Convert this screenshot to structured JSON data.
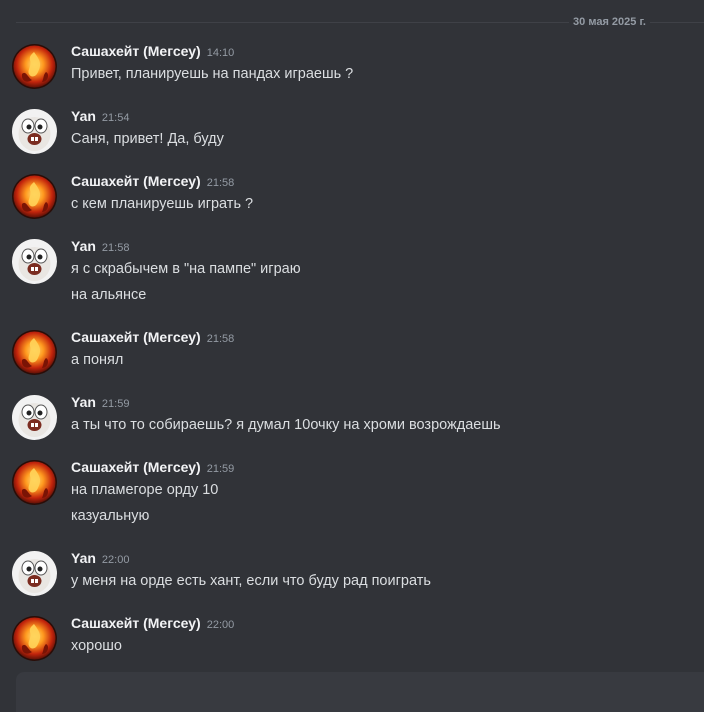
{
  "date_divider": "30 мая 2025 г.",
  "messages": [
    {
      "author": "Сашахейт (Мегсеу)",
      "time": "14:10",
      "avatar_icon": "fire-avatar-icon",
      "lines": [
        "Привет, планируешь на пандах играешь ?"
      ]
    },
    {
      "author": "Yan",
      "time": "21:54",
      "avatar_icon": "cartoon-face-avatar-icon",
      "lines": [
        "Саня, привет! Да, буду"
      ]
    },
    {
      "author": "Сашахейт (Мегсеу)",
      "time": "21:58",
      "avatar_icon": "fire-avatar-icon",
      "lines": [
        "с кем планируешь играть ?"
      ]
    },
    {
      "author": "Yan",
      "time": "21:58",
      "avatar_icon": "cartoon-face-avatar-icon",
      "lines": [
        "я с скрабычем в \"на пампе\" играю",
        "на альянсе"
      ]
    },
    {
      "author": "Сашахейт (Мегсеу)",
      "time": "21:58",
      "avatar_icon": "fire-avatar-icon",
      "lines": [
        "а понял"
      ]
    },
    {
      "author": "Yan",
      "time": "21:59",
      "avatar_icon": "cartoon-face-avatar-icon",
      "lines": [
        "а ты что то собираешь? я думал 10очку на хроми возрождаешь"
      ]
    },
    {
      "author": "Сашахейт (Мегсеу)",
      "time": "21:59",
      "avatar_icon": "fire-avatar-icon",
      "lines": [
        "на пламегоре орду 10",
        "казуальную"
      ]
    },
    {
      "author": "Yan",
      "time": "22:00",
      "avatar_icon": "cartoon-face-avatar-icon",
      "lines": [
        "у меня на орде есть хант,  если что буду рад поиграть"
      ]
    },
    {
      "author": "Сашахейт (Мегсеу)",
      "time": "22:00",
      "avatar_icon": "fire-avatar-icon",
      "lines": [
        "хорошо"
      ]
    }
  ],
  "colors": {
    "background": "#313338",
    "text": "#dbdee1",
    "author": "#f2f3f5",
    "muted": "#949ba4"
  }
}
